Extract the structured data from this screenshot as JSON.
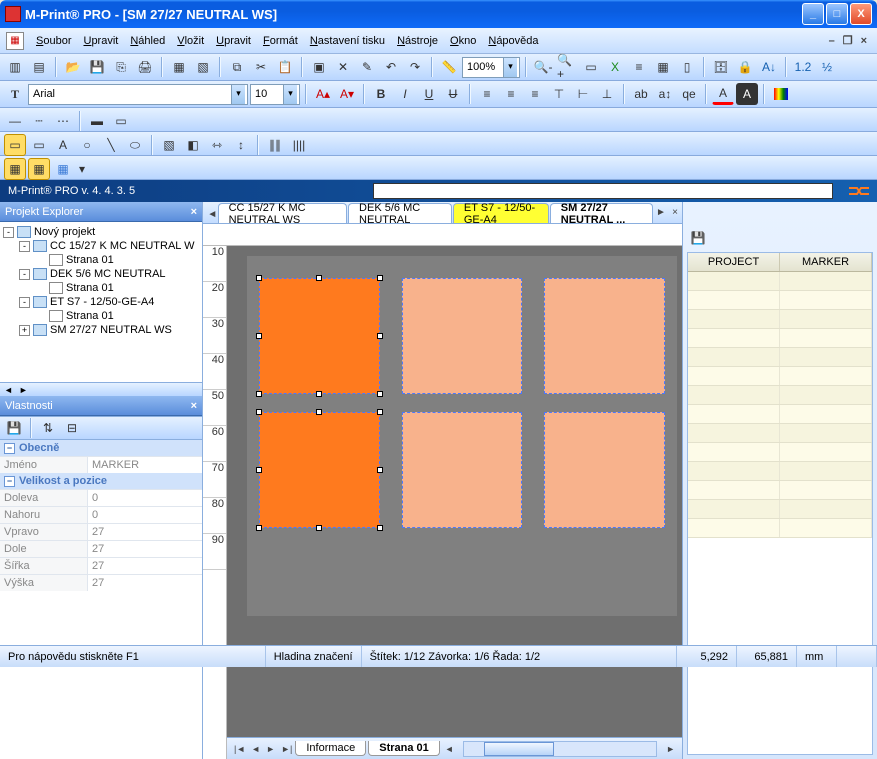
{
  "window": {
    "title": "M-Print® PRO - [SM 27/27 NEUTRAL WS]"
  },
  "menu": {
    "items": [
      "Soubor",
      "Upravit",
      "Náhled",
      "Vložit",
      "Upravit",
      "Formát",
      "Nastavení tisku",
      "Nástroje",
      "Okno",
      "Nápověda"
    ]
  },
  "toolbar": {
    "zoom": "100%",
    "font": "Arial",
    "fontsize": "10"
  },
  "version": {
    "label": "M-Print® PRO v. 4. 4. 3. 5"
  },
  "explorer": {
    "title": "Projekt Explorer",
    "nodes": [
      {
        "depth": 0,
        "twisty": "-",
        "icon": "proj",
        "label": "Nový projekt"
      },
      {
        "depth": 1,
        "twisty": "-",
        "icon": "plate",
        "label": "CC 15/27 K MC NEUTRAL W"
      },
      {
        "depth": 2,
        "twisty": "",
        "icon": "page",
        "label": "Strana 01"
      },
      {
        "depth": 1,
        "twisty": "-",
        "icon": "plate",
        "label": "DEK 5/6 MC NEUTRAL"
      },
      {
        "depth": 2,
        "twisty": "",
        "icon": "page",
        "label": "Strana 01"
      },
      {
        "depth": 1,
        "twisty": "-",
        "icon": "plate",
        "label": "ET S7 - 12/50-GE-A4"
      },
      {
        "depth": 2,
        "twisty": "",
        "icon": "page",
        "label": "Strana 01"
      },
      {
        "depth": 1,
        "twisty": "+",
        "icon": "plate",
        "label": "SM 27/27 NEUTRAL WS"
      }
    ]
  },
  "properties": {
    "title": "Vlastnosti",
    "section_general": "Obecně",
    "section_size": "Velikost a pozice",
    "name_label": "Jméno",
    "name_value": "MARKER",
    "rows": [
      {
        "label": "Doleva",
        "value": "0"
      },
      {
        "label": "Nahoru",
        "value": "0"
      },
      {
        "label": "Vpravo",
        "value": "27"
      },
      {
        "label": "Dole",
        "value": "27"
      },
      {
        "label": "Šířka",
        "value": "27"
      },
      {
        "label": "Výška",
        "value": "27"
      }
    ]
  },
  "tabs": {
    "items": [
      {
        "label": "CC 15/27 K MC NEUTRAL WS",
        "highlight": false,
        "active": false
      },
      {
        "label": "DEK 5/6 MC NEUTRAL",
        "highlight": false,
        "active": false
      },
      {
        "label": "ET S7 - 12/50-GE-A4",
        "highlight": true,
        "active": false
      },
      {
        "label": "SM 27/27 NEUTRAL ...",
        "highlight": false,
        "active": true
      }
    ]
  },
  "ruler": {
    "v": [
      "10",
      "20",
      "30",
      "40",
      "50",
      "60",
      "70",
      "80",
      "90"
    ]
  },
  "bottomtabs": {
    "info": "Informace",
    "page": "Strana 01"
  },
  "rightgrid": {
    "headers": [
      "PROJECT",
      "MARKER"
    ]
  },
  "status": {
    "help": "Pro nápovědu stiskněte F1",
    "layer": "Hladina značení",
    "label": "Štítek: 1/12 Závorka: 1/6 Řada: 1/2",
    "x": "5,292",
    "y": "65,881",
    "unit": "mm"
  }
}
